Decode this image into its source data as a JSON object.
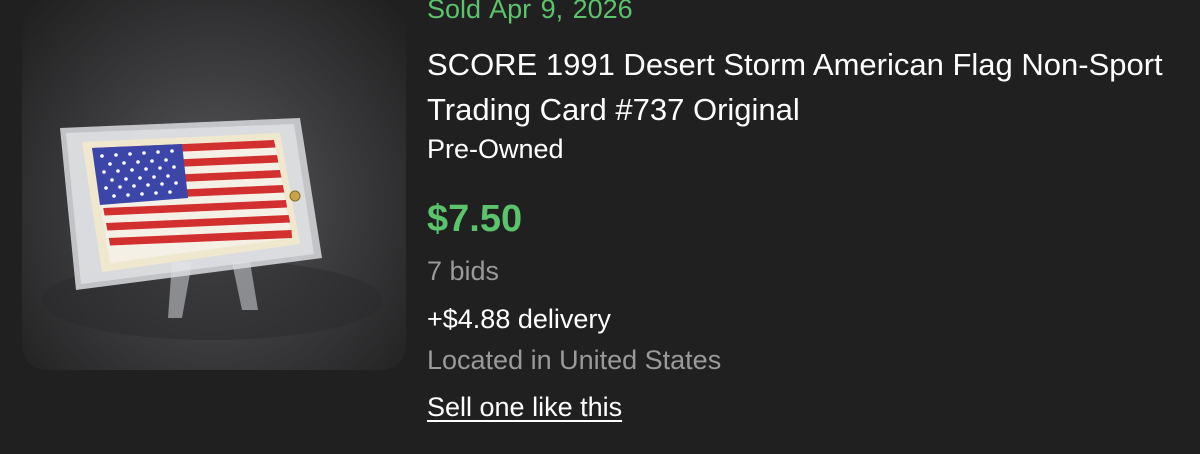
{
  "listing": {
    "sold_prefix": "Sold",
    "sold_date": "Apr 9, 2026",
    "title": "SCORE 1991 Desert Storm American Flag Non-Sport Trading Card #737 Original",
    "condition": "Pre-Owned",
    "price": "$7.50",
    "bids": "7 bids",
    "delivery": "+$4.88 delivery",
    "location": "Located in United States",
    "sell_link": "Sell one like this"
  },
  "colors": {
    "background": "#202020",
    "accent_green": "#5cc36d",
    "muted_text": "#9a9a9a",
    "flag_red": "#d22f2f",
    "flag_blue": "#3b46a8"
  },
  "icons": {
    "thumbnail": "flag-trading-card-photo"
  }
}
